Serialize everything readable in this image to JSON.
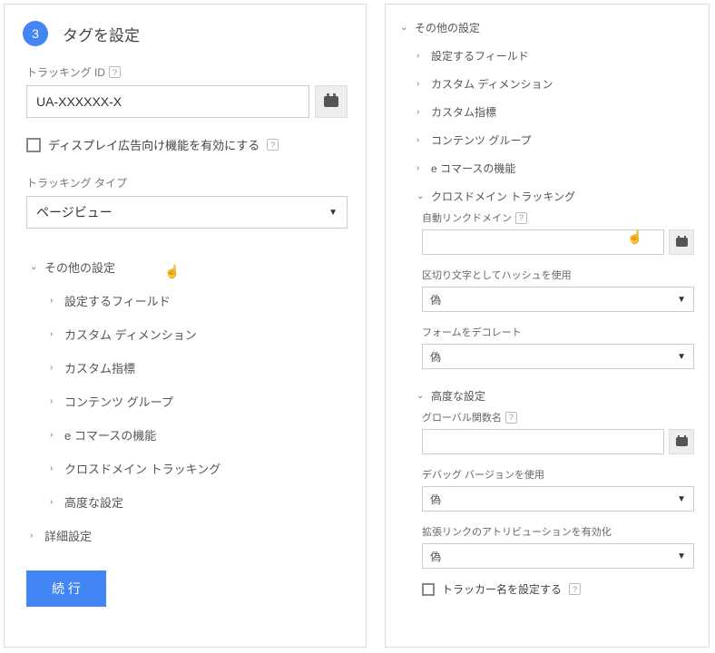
{
  "step": {
    "number": "3",
    "title": "タグを設定"
  },
  "tracking_id": {
    "label": "トラッキング ID",
    "value": "UA-XXXXXX-X"
  },
  "display_ads": {
    "label": "ディスプレイ広告向け機能を有効にする"
  },
  "tracking_type": {
    "label": "トラッキング タイプ",
    "value": "ページビュー"
  },
  "tree": {
    "other_settings": "その他の設定",
    "fields_to_set": "設定するフィールド",
    "custom_dimension": "カスタム ディメンション",
    "custom_metric": "カスタム指標",
    "content_groups": "コンテンツ グループ",
    "ecommerce": "e コマースの機能",
    "cross_domain": "クロスドメイン トラッキング",
    "advanced_config": "高度な設定",
    "detail_settings": "詳細設定"
  },
  "continue_btn": "続 行",
  "right": {
    "auto_link": {
      "label": "自動リンクドメイン",
      "value": ""
    },
    "hash_delim": {
      "label": "区切り文字としてハッシュを使用",
      "value": "偽"
    },
    "decorate_form": {
      "label": "フォームをデコレート",
      "value": "偽"
    },
    "global_fn": {
      "label": "グローバル関数名",
      "value": ""
    },
    "debug_version": {
      "label": "デバッグ バージョンを使用",
      "value": "偽"
    },
    "enhanced_link": {
      "label": "拡張リンクのアトリビューションを有効化",
      "value": "偽"
    },
    "tracker_name": {
      "label": "トラッカー名を設定する"
    }
  }
}
